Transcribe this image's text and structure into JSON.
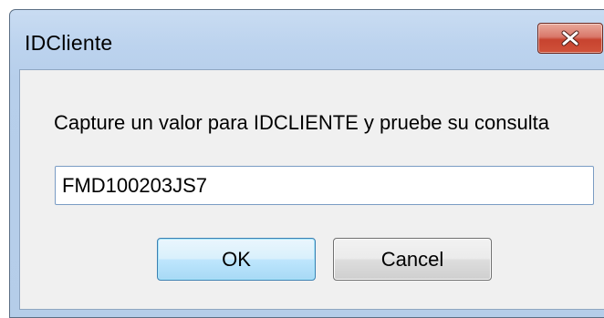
{
  "window": {
    "title": "IDCliente",
    "close_icon": "close-icon"
  },
  "dialog": {
    "prompt": "Capture un valor para IDCLIENTE y pruebe su consulta",
    "input_value": "FMD100203JS7",
    "ok_label": "OK",
    "cancel_label": "Cancel"
  },
  "colors": {
    "frame": "#b7cfeb",
    "client_bg": "#f0f0f0",
    "close_red": "#c7432f",
    "ok_border": "#3c7fb1"
  }
}
